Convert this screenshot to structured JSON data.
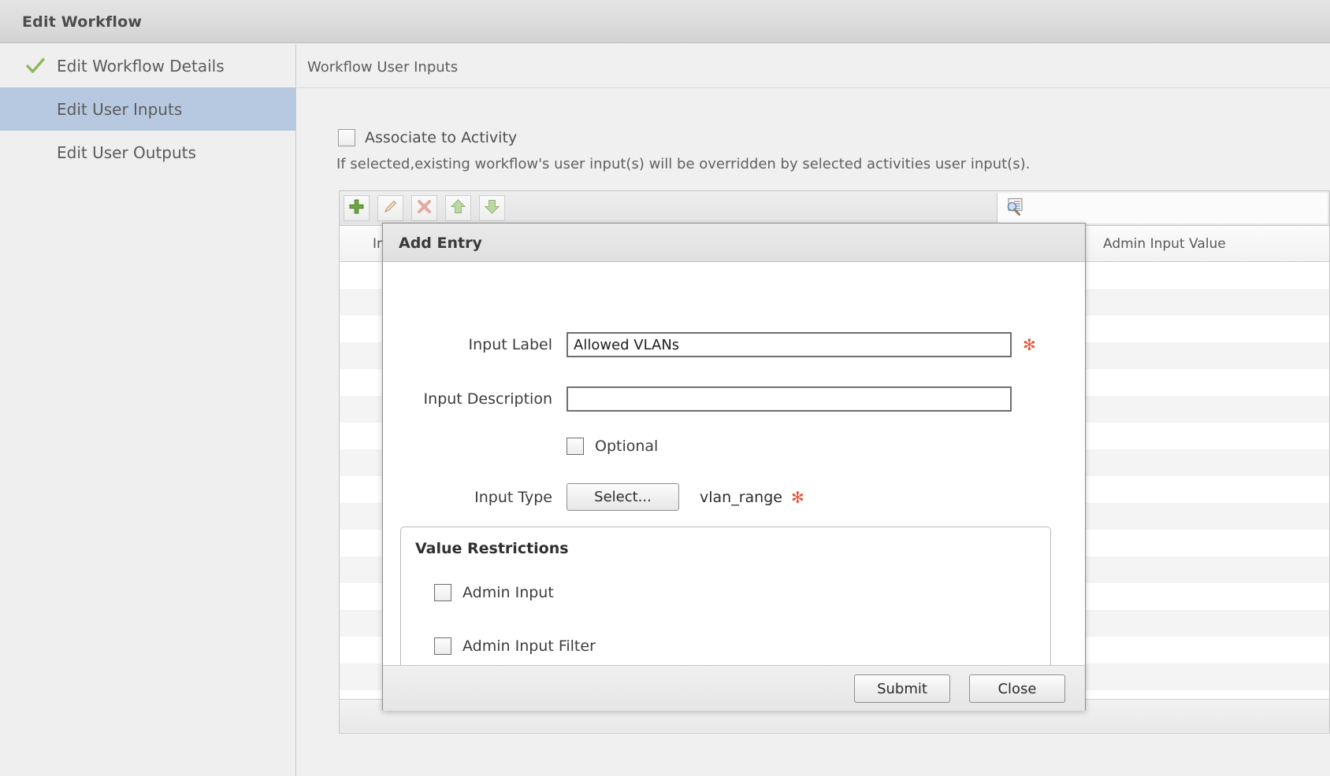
{
  "window": {
    "title": "Edit Workflow"
  },
  "sidebar": {
    "items": [
      {
        "label": "Edit Workflow Details",
        "icon": "check-icon",
        "completed": true,
        "active": false
      },
      {
        "label": "Edit User Inputs",
        "icon": "",
        "completed": false,
        "active": true
      },
      {
        "label": "Edit User Outputs",
        "icon": "",
        "completed": false,
        "active": false
      }
    ]
  },
  "content": {
    "header": "Workflow User Inputs",
    "associate": {
      "label": "Associate to Activity",
      "checked": false,
      "note": "If selected,existing workflow's user input(s) will be overridden by selected activities user input(s)."
    },
    "toolbar": {
      "buttons": [
        {
          "name": "add-button",
          "icon": "plus-icon"
        },
        {
          "name": "edit-button",
          "icon": "pencil-icon"
        },
        {
          "name": "delete-button",
          "icon": "x-icon"
        },
        {
          "name": "move-up-button",
          "icon": "arrow-up-icon"
        },
        {
          "name": "move-down-button",
          "icon": "arrow-down-icon"
        }
      ],
      "search_icon": "search-list-icon"
    },
    "grid": {
      "columns": [
        "Input Label",
        "Admin Input Value"
      ]
    }
  },
  "modal": {
    "title": "Add Entry",
    "fields": {
      "input_label": {
        "label": "Input Label",
        "value": "Allowed VLANs",
        "placeholder": "",
        "required_marker": "✻"
      },
      "input_description": {
        "label": "Input Description",
        "value": "",
        "placeholder": ""
      },
      "optional": {
        "label": "Optional",
        "checked": false
      },
      "input_type": {
        "label": "Input Type",
        "button_label": "Select...",
        "value": "vlan_range",
        "required_marker": "✻"
      }
    },
    "value_restrictions": {
      "title": "Value Restrictions",
      "items": [
        {
          "label": "Admin Input",
          "checked": false
        },
        {
          "label": "Admin Input Filter",
          "checked": false
        }
      ]
    },
    "footer": {
      "submit_label": "Submit",
      "close_label": "Close"
    }
  },
  "colors": {
    "accent_selected": "#b7c9e0",
    "required": "#e8563a",
    "check_green": "#8cb85a"
  }
}
